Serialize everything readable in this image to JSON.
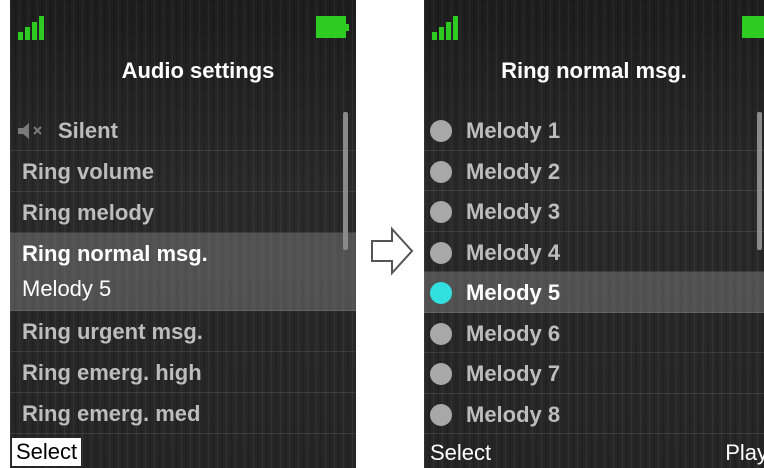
{
  "left_screen": {
    "title": "Audio settings",
    "items": [
      {
        "label": "Silent",
        "icon": "mute-icon"
      },
      {
        "label": "Ring volume"
      },
      {
        "label": "Ring melody"
      },
      {
        "label": "Ring normal msg.",
        "value": "Melody 5",
        "selected": true
      },
      {
        "label": "Ring urgent msg."
      },
      {
        "label": "Ring emerg. high"
      },
      {
        "label": "Ring emerg. med"
      }
    ],
    "softkeys": {
      "left": "Select"
    }
  },
  "right_screen": {
    "title": "Ring normal msg.",
    "options": [
      {
        "label": "Melody 1"
      },
      {
        "label": "Melody 2"
      },
      {
        "label": "Melody 3"
      },
      {
        "label": "Melody 4"
      },
      {
        "label": "Melody 5",
        "selected": true
      },
      {
        "label": "Melody 6"
      },
      {
        "label": "Melody 7"
      },
      {
        "label": "Melody 8"
      }
    ],
    "softkeys": {
      "left": "Select",
      "right": "Play"
    }
  },
  "colors": {
    "status_green": "#2ecc23",
    "radio_selected": "#33e0e0",
    "radio_unselected": "#a8a8a8"
  }
}
